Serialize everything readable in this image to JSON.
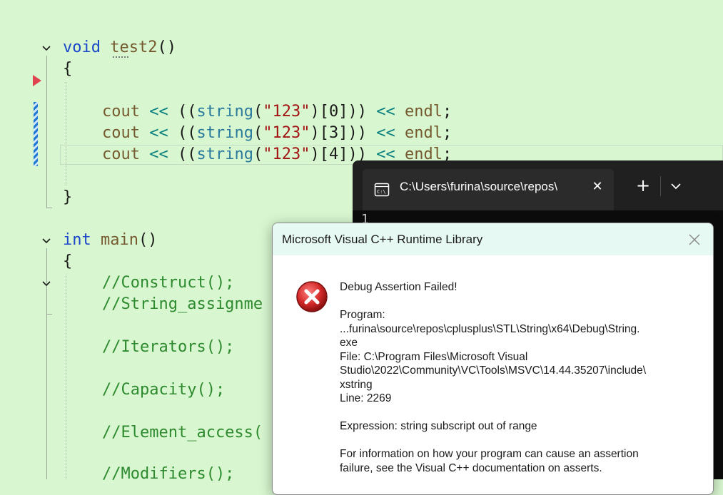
{
  "editor": {
    "lines": [
      {
        "type": "func",
        "ret": "void",
        "name": "test2",
        "parens": "()"
      },
      {
        "type": "brace",
        "text": "{"
      },
      {
        "type": "cout",
        "idx": "0"
      },
      {
        "type": "cout",
        "idx": "3"
      },
      {
        "type": "cout",
        "idx": "4"
      },
      {
        "type": "brace",
        "text": "}"
      },
      {
        "type": "func",
        "ret": "int",
        "name": "main",
        "parens": "()"
      },
      {
        "type": "brace",
        "text": "{"
      }
    ],
    "cout": {
      "stream": "cout",
      "op": "<<",
      "open": "((",
      "type": "string",
      "lp": "(",
      "literal": "\"123\"",
      "rp": ")",
      "lb": "[",
      "rb": "]",
      "close": "))",
      "endl": "endl",
      "semi": ";"
    },
    "comments": [
      "//Construct();",
      "//String_assignme",
      "//Iterators();",
      "//Capacity();",
      "//Element_access(",
      "//Modifiers();"
    ]
  },
  "terminal": {
    "tab_title": "C:\\Users\\furina\\source\\repos\\",
    "close_glyph": "✕",
    "new_tab_glyph": "+",
    "output": "1"
  },
  "dialog": {
    "title": "Microsoft Visual C++ Runtime Library",
    "heading": "Debug Assertion Failed!",
    "program_label": "Program:",
    "program_path_1": "...furina\\source\\repos\\cplusplus\\STL\\String\\x64\\Debug\\String.",
    "program_path_2": "exe",
    "file_1": "File: C:\\Program Files\\Microsoft Visual",
    "file_2": "Studio\\2022\\Community\\VC\\Tools\\MSVC\\14.44.35207\\include\\",
    "file_3": "xstring",
    "line": "Line: 2269",
    "expression": "Expression: string subscript out of range",
    "info_1": "For information on how your program can cause an assertion",
    "info_2": "failure, see the Visual C++ documentation on asserts."
  },
  "colors": {
    "editor_bg": "#d8f7d0",
    "keyword": "#1a47c9",
    "function": "#75592f",
    "type": "#2b7a9c",
    "string": "#a31515",
    "comment": "#2e8a2e",
    "error_icon": "#d42a2a"
  },
  "icons": {
    "fold": "chevron-down-icon",
    "breakpoint": "play-arrow-icon",
    "terminal_tab": "terminal-icon",
    "dropdown": "chevron-down-icon",
    "dialog_close": "close-icon",
    "error": "error-icon"
  }
}
